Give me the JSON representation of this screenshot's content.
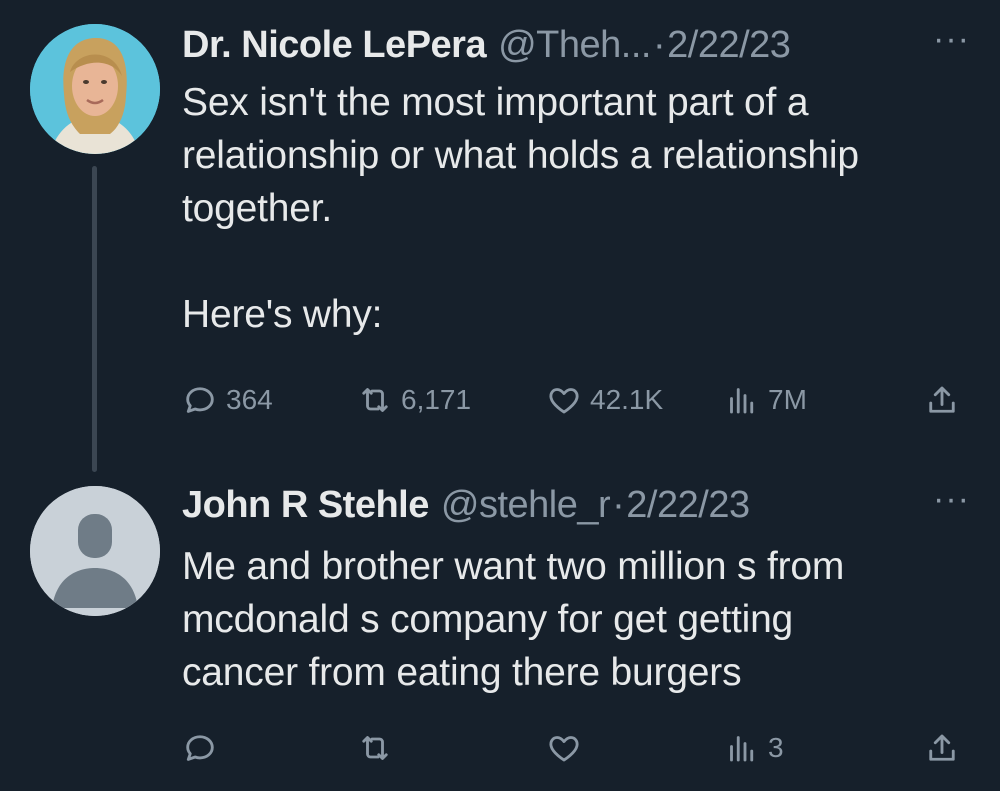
{
  "tweets": [
    {
      "name": "Dr. Nicole LePera",
      "handle": "@Theh...",
      "separator": "·",
      "date": "2/22/23",
      "more": "···",
      "body_lines": [
        "Sex isn't the most important part of a",
        "relationship or what holds a relationship",
        "together.",
        "",
        "Here's why:"
      ],
      "stats": {
        "replies": "364",
        "retweets": "6,171",
        "likes": "42.1K",
        "views": "7M"
      },
      "icons": [
        "reply-icon",
        "retweet-icon",
        "like-icon",
        "views-icon",
        "share-icon"
      ]
    },
    {
      "name": "John R Stehle",
      "handle": "@stehle_r",
      "separator": "·",
      "date": "2/22/23",
      "more": "···",
      "body_lines": [
        "Me and brother want two million s from",
        "mcdonald s company for get getting",
        "cancer from eating there burgers"
      ],
      "stats": {
        "replies": "",
        "retweets": "",
        "likes": "",
        "views": "3"
      },
      "icons": [
        "reply-icon",
        "retweet-icon",
        "like-icon",
        "views-icon",
        "share-icon"
      ]
    }
  ],
  "colors": {
    "background": "#16202b",
    "text_primary": "#e7e9ea",
    "text_secondary": "#8b98a5",
    "thread_line": "#3b4652"
  }
}
